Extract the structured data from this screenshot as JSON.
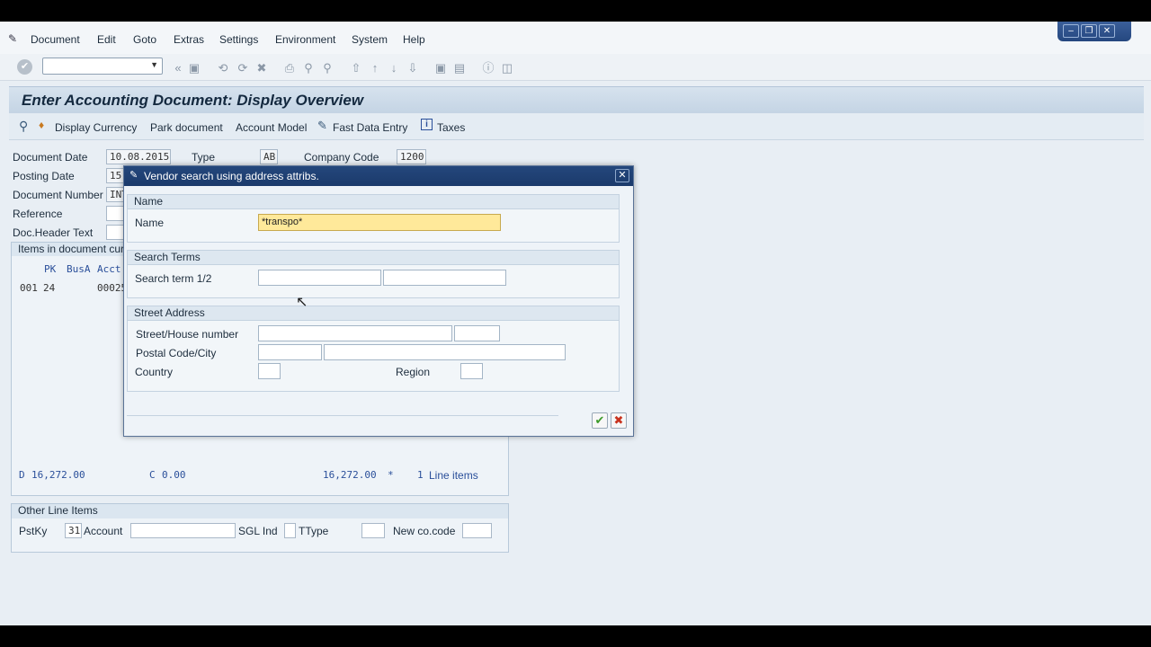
{
  "menu": [
    "Document",
    "Edit",
    "Goto",
    "Extras",
    "Settings",
    "Environment",
    "System",
    "Help"
  ],
  "window_controls": [
    "minimize",
    "restore",
    "close"
  ],
  "title": "Enter Accounting Document: Display Overview",
  "app_toolbar": {
    "display_currency": "Display Currency",
    "park_document": "Park document",
    "account_model": "Account Model",
    "fast_data_entry": "Fast Data Entry",
    "taxes": "Taxes"
  },
  "header": {
    "document_date_label": "Document Date",
    "document_date": "10.08.2015",
    "type_label": "Type",
    "type": "AB",
    "company_code_label": "Company Code",
    "company_code": "1200",
    "posting_date_label": "Posting Date",
    "posting_date": "15",
    "document_number_label": "Document Number",
    "document_number": "INT",
    "reference_label": "Reference",
    "doc_header_text_label": "Doc.Header Text"
  },
  "items": {
    "section_title": "Items in document cur",
    "col_pk": "PK",
    "col_busa": "BusA",
    "col_acct": "Acct",
    "row_no": "001",
    "row_pk": "24",
    "row_acct": "00025",
    "debit_label": "D",
    "debit": "16,272.00",
    "credit_label": "C",
    "credit": "0.00",
    "balance": "16,272.00",
    "star": "*",
    "line_count": "1",
    "line_items": "Line items"
  },
  "other_line_items": {
    "title": "Other Line Items",
    "pstky_label": "PstKy",
    "pstky": "31",
    "account_label": "Account",
    "sgl_label": "SGL Ind",
    "ttype_label": "TType",
    "new_cocode_label": "New co.code"
  },
  "dialog": {
    "title": "Vendor search using address attribs.",
    "name_group": "Name",
    "name_label": "Name",
    "name_value": "*transpo*",
    "search_group": "Search Terms",
    "search_label": "Search term 1/2",
    "address_group": "Street Address",
    "street_label": "Street/House number",
    "postal_label": "Postal Code/City",
    "country_label": "Country",
    "region_label": "Region"
  },
  "colors": {
    "title_bar": "#1b3a6b",
    "highlight_field": "#ffe99a",
    "blue_text": "#2a4f9a",
    "ok_green": "#3c9a2a",
    "cancel_red": "#c8321e"
  }
}
